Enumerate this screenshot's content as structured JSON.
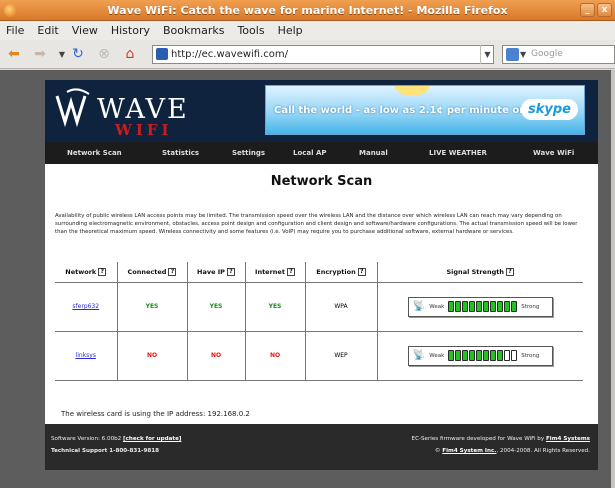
{
  "window": {
    "title": "Wave WiFi: Catch the wave for marine Internet! - Mozilla Firefox",
    "minimize": "_",
    "close": "x"
  },
  "menu": [
    "File",
    "Edit",
    "View",
    "History",
    "Bookmarks",
    "Tools",
    "Help"
  ],
  "toolbar": {
    "url": "http://ec.wavewifi.com/",
    "search_placeholder": "Google"
  },
  "site": {
    "logo_word": "WAVE",
    "logo_sub": "WIFI",
    "ad_text": "Call the world - as low as 2.1¢ per minute on Skype.",
    "ad_brand": "skype",
    "nav": [
      "Network Scan",
      "Statistics",
      "Settings",
      "Local AP",
      "Manual",
      "LIVE WEATHER",
      "Wave WiFi"
    ]
  },
  "content": {
    "heading": "Network Scan",
    "intro": "Availability of public wireless LAN access points may be limited. The transmission speed over the wireless LAN and the distance over which wireless LAN can reach may vary depending on surrounding electromagnetic environment, obstacles, access point design and configuration and client design and software/hardware configurations. The actual transmission speed will be lower than the theoretical maximum speed. Wireless connectivity and some features (i.e. VoIP) may require you to purchase additional software, external hardware or services.",
    "columns": [
      "Network",
      "Connected",
      "Have IP",
      "Internet",
      "Encryption",
      "Signal Strength"
    ],
    "help_glyph": "?",
    "signal_weak": "Weak",
    "signal_strong": "Strong",
    "rows": [
      {
        "network": "sferp632",
        "connected": "YES",
        "have_ip": "YES",
        "internet": "YES",
        "encryption": "WPA",
        "signal_bars": 10,
        "signal_total": 10
      },
      {
        "network": "linksys",
        "connected": "NO",
        "have_ip": "NO",
        "internet": "NO",
        "encryption": "WEP",
        "signal_bars": 8,
        "signal_total": 10
      }
    ],
    "ip_text": "The wireless card is using the IP address: 192.168.0.2"
  },
  "footer": {
    "version": "Software Version: 6.00b2",
    "check_update": "[check for update]",
    "support": "Technical Support 1-800-831-9818",
    "firmware": "EC-Series firmware developed for Wave WiFi by",
    "company": "Fim4 Systems",
    "copyright_prefix": "©",
    "company2": "Fim4 System Inc.",
    "copyright_suffix": ", 2004-2008. All Rights Reserved."
  }
}
